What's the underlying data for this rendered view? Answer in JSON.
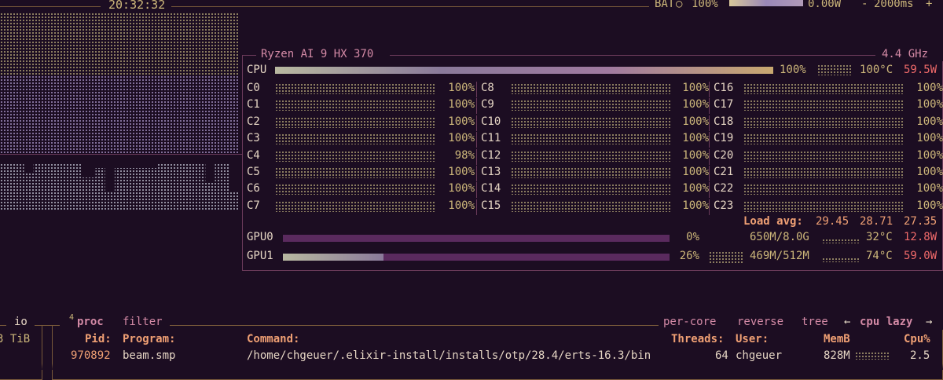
{
  "top": {
    "clock": "20:32:32",
    "battery_label": "BAT",
    "battery_icon": "○",
    "battery_pct": "100%",
    "battery_fill": 1.0,
    "power": "0.00W",
    "minus": "-",
    "interval": "2000ms",
    "plus": "+"
  },
  "cpu": {
    "model": "Ryzen AI 9 HX 370",
    "freq": "4.4 GHz",
    "total_label": "CPU",
    "total_pct": "100%",
    "total_fill": 1.0,
    "temp": "100°C",
    "power": "59.5W",
    "cores": [
      {
        "name": "C0",
        "pct": "100%"
      },
      {
        "name": "C1",
        "pct": "100%"
      },
      {
        "name": "C2",
        "pct": "100%"
      },
      {
        "name": "C3",
        "pct": "100%"
      },
      {
        "name": "C4",
        "pct": "98%"
      },
      {
        "name": "C5",
        "pct": "100%"
      },
      {
        "name": "C6",
        "pct": "100%"
      },
      {
        "name": "C7",
        "pct": "100%"
      },
      {
        "name": "C8",
        "pct": "100%"
      },
      {
        "name": "C9",
        "pct": "100%"
      },
      {
        "name": "C10",
        "pct": "100%"
      },
      {
        "name": "C11",
        "pct": "100%"
      },
      {
        "name": "C12",
        "pct": "100%"
      },
      {
        "name": "C13",
        "pct": "100%"
      },
      {
        "name": "C14",
        "pct": "100%"
      },
      {
        "name": "C15",
        "pct": "100%"
      },
      {
        "name": "C16",
        "pct": "100%"
      },
      {
        "name": "C17",
        "pct": "100%"
      },
      {
        "name": "C18",
        "pct": "100%"
      },
      {
        "name": "C19",
        "pct": "100%"
      },
      {
        "name": "C20",
        "pct": "100%"
      },
      {
        "name": "C21",
        "pct": "100%"
      },
      {
        "name": "C22",
        "pct": "100%"
      },
      {
        "name": "C23",
        "pct": "100%"
      }
    ],
    "load_label": "Load avg:",
    "load": [
      "29.45",
      "28.71",
      "27.35"
    ]
  },
  "gpus": [
    {
      "name": "GPU0",
      "pct": "0%",
      "fill": 0.0,
      "mem": "650M/8.0G",
      "temp": "32°C",
      "power": "12.8W"
    },
    {
      "name": "GPU1",
      "pct": "26%",
      "fill": 0.26,
      "mem": "469M/512M",
      "temp": "74°C",
      "power": "59.0W"
    }
  ],
  "proc": {
    "io_label": "io",
    "io_value": "3 TiB",
    "number": "4",
    "title": "proc",
    "filter": "filter",
    "options": [
      "per-core",
      "reverse",
      "tree"
    ],
    "sort_left": "←",
    "sort": "cpu lazy",
    "sort_right": "→",
    "headers": {
      "pid": "Pid:",
      "program": "Program:",
      "command": "Command:",
      "threads": "Threads:",
      "user": "User:",
      "mem": "MemB",
      "cpu": "Cpu%"
    },
    "rows": [
      {
        "pid": "970892",
        "program": "beam.smp",
        "command": "/home/chgeuer/.elixir-install/installs/otp/28.4/erts-16.3/bin",
        "threads": "64",
        "user": "chgeuer",
        "mem": "828M",
        "cpu": "2.5"
      }
    ]
  }
}
